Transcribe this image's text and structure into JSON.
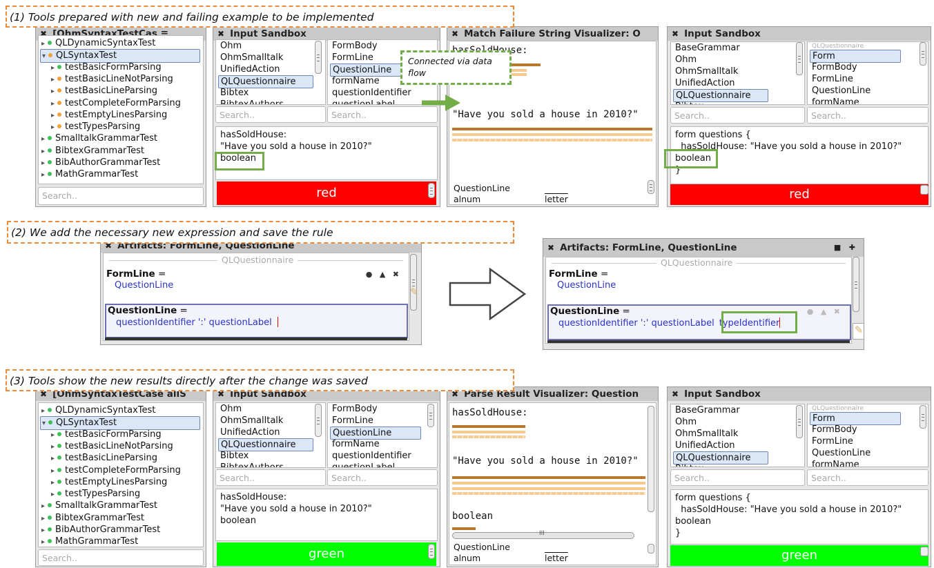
{
  "callouts": {
    "step1": "(1) Tools prepared with new and failing example to be implemented",
    "step2": "(2) We add the necessary new expression and save the rule",
    "step3": "(3) Tools show the new results directly after the change was saved",
    "dataflow": "Connected via data flow"
  },
  "top": {
    "test_runner": {
      "title": "[OhmSyntaxTestCas ≡",
      "items": [
        {
          "label": "QLDynamicSyntaxTest",
          "indent": 0,
          "status": "green",
          "expand": "▸",
          "selected": false
        },
        {
          "label": "QLSyntaxTest",
          "indent": 0,
          "status": "orange",
          "expand": "▾",
          "selected": true
        },
        {
          "label": "testBasicFormParsing",
          "indent": 1,
          "status": "green",
          "expand": "▸",
          "selected": false
        },
        {
          "label": "testBasicLineNotParsing",
          "indent": 1,
          "status": "orange",
          "expand": "▸",
          "selected": false
        },
        {
          "label": "testBasicLineParsing",
          "indent": 1,
          "status": "orange",
          "expand": "▸",
          "selected": false
        },
        {
          "label": "testCompleteFormParsing",
          "indent": 1,
          "status": "orange",
          "expand": "▸",
          "selected": false
        },
        {
          "label": "testEmptyLinesParsing",
          "indent": 1,
          "status": "orange",
          "expand": "▸",
          "selected": false
        },
        {
          "label": "testTypesParsing",
          "indent": 1,
          "status": "orange",
          "expand": "▸",
          "selected": false
        },
        {
          "label": "SmalltalkGrammarTest",
          "indent": 0,
          "status": "green",
          "expand": "▸",
          "selected": false
        },
        {
          "label": "BibtexGrammarTest",
          "indent": 0,
          "status": "green",
          "expand": "▸",
          "selected": false
        },
        {
          "label": "BibAuthorGrammarTest",
          "indent": 0,
          "status": "green",
          "expand": "▸",
          "selected": false
        },
        {
          "label": "MathGrammarTest",
          "indent": 0,
          "status": "green",
          "expand": "▸",
          "selected": false
        }
      ],
      "search_placeholder": "Search.."
    },
    "sandbox1": {
      "title": "Input Sandbox",
      "grammars": [
        "Ohm",
        "OhmSmalltalk",
        "UnifiedAction",
        "QLQuestionnaire",
        "Bibtex",
        "BibtexAuthors"
      ],
      "grammar_selected": 3,
      "rules": [
        "FormBody",
        "FormLine",
        "QuestionLine",
        "formName",
        "questionIdentifier",
        "questionLabel"
      ],
      "rule_selected": 2,
      "search_left": "Search..",
      "search_right": "Search..",
      "input_lines": [
        "hasSoldHouse:",
        "\"Have you sold a house in 2010?\"",
        "boolean"
      ],
      "status": "red"
    },
    "visualizer": {
      "title": "Match Failure String Visualizer: O",
      "line1": "hasSoldHouse:",
      "line2": "\"Have you sold a house in 2010?\"",
      "footer_rule": "QuestionLine",
      "footer_left": "alnum",
      "footer_right": "letter"
    },
    "sandbox2": {
      "title": "Input Sandbox",
      "grammars": [
        "BaseGrammar",
        "Ohm",
        "OhmSmalltalk",
        "UnifiedAction",
        "QLQuestionnaire",
        "Bibtex"
      ],
      "grammar_selected": 4,
      "rules_header": "QLQuestionnaire",
      "rules": [
        "Form",
        "FormBody",
        "FormLine",
        "QuestionLine",
        "formName"
      ],
      "rule_selected": 0,
      "search_left": "Search..",
      "search_right": "Search..",
      "input_lines": [
        "form questions {",
        "  hasSoldHouse: \"Have you sold a house in 2010?\"",
        "boolean",
        "}"
      ],
      "status": "red"
    }
  },
  "middle": {
    "before": {
      "title": "Artifacts: FormLine, QuestionLine",
      "grammar": "QLQuestionnaire",
      "rule1_name": "FormLine",
      "rule1_op": " =",
      "rule1_body": "QuestionLine",
      "rule2_name": "QuestionLine",
      "rule2_op": " =",
      "rule2_body": "questionIdentifier ':' questionLabel"
    },
    "after": {
      "title": "Artifacts: FormLine, QuestionLine",
      "grammar": "QLQuestionnaire",
      "rule1_name": "FormLine",
      "rule1_op": " =",
      "rule1_body": "QuestionLine",
      "rule2_name": "QuestionLine",
      "rule2_op": " =",
      "rule2_body": "questionIdentifier ':' questionLabel",
      "rule2_added": "typeIdentifier"
    }
  },
  "bottom": {
    "test_runner": {
      "title": "[OhmSyntaxTestCase allS",
      "items": [
        {
          "label": "QLDynamicSyntaxTest",
          "indent": 0,
          "status": "green",
          "expand": "▸",
          "selected": false
        },
        {
          "label": "QLSyntaxTest",
          "indent": 0,
          "status": "green",
          "expand": "▾",
          "selected": true
        },
        {
          "label": "testBasicFormParsing",
          "indent": 1,
          "status": "green",
          "expand": "▸",
          "selected": false
        },
        {
          "label": "testBasicLineNotParsing",
          "indent": 1,
          "status": "green",
          "expand": "▸",
          "selected": false
        },
        {
          "label": "testBasicLineParsing",
          "indent": 1,
          "status": "green",
          "expand": "▸",
          "selected": false
        },
        {
          "label": "testCompleteFormParsing",
          "indent": 1,
          "status": "green",
          "expand": "▸",
          "selected": false
        },
        {
          "label": "testEmptyLinesParsing",
          "indent": 1,
          "status": "green",
          "expand": "▸",
          "selected": false
        },
        {
          "label": "testTypesParsing",
          "indent": 1,
          "status": "green",
          "expand": "▸",
          "selected": false
        },
        {
          "label": "SmalltalkGrammarTest",
          "indent": 0,
          "status": "green",
          "expand": "▸",
          "selected": false
        },
        {
          "label": "BibtexGrammarTest",
          "indent": 0,
          "status": "green",
          "expand": "▸",
          "selected": false
        },
        {
          "label": "BibAuthorGrammarTest",
          "indent": 0,
          "status": "green",
          "expand": "▸",
          "selected": false
        },
        {
          "label": "MathGrammarTest",
          "indent": 0,
          "status": "green",
          "expand": "▸",
          "selected": false
        }
      ],
      "search_placeholder": "Search.."
    },
    "sandbox1": {
      "title": "Input Sandbox",
      "grammars": [
        "Ohm",
        "OhmSmalltalk",
        "UnifiedAction",
        "QLQuestionnaire",
        "Bibtex",
        "BibtexAuthors"
      ],
      "grammar_selected": 3,
      "rules": [
        "FormBody",
        "FormLine",
        "QuestionLine",
        "formName",
        "questionIdentifier",
        "questionLabel"
      ],
      "rule_selected": 2,
      "search_left": "Search..",
      "search_right": "Search..",
      "input_lines": [
        "hasSoldHouse:",
        "\"Have you sold a house in 2010?\"",
        "boolean"
      ],
      "status": "green"
    },
    "visualizer": {
      "title": "Parse Result Visualizer: Question",
      "line1": "hasSoldHouse:",
      "line2": "\"Have you sold a house in 2010?\"",
      "line3": "boolean",
      "footer_rule": "QuestionLine",
      "footer_left": "alnum",
      "footer_right": "letter"
    },
    "sandbox2": {
      "title": "Input Sandbox",
      "grammars": [
        "BaseGrammar",
        "Ohm",
        "OhmSmalltalk",
        "UnifiedAction",
        "QLQuestionnaire",
        "Bibtex"
      ],
      "grammar_selected": 4,
      "rules_header": "QLQuestionnaire",
      "rules": [
        "Form",
        "FormBody",
        "FormLine",
        "QuestionLine",
        "formName"
      ],
      "rule_selected": 0,
      "search_left": "Search..",
      "search_right": "Search..",
      "input_lines": [
        "form questions {",
        "  hasSoldHouse: \"Have you sold a house in 2010?\"",
        "boolean",
        "}"
      ],
      "status": "green"
    }
  },
  "colors": {
    "red": "#ff0000",
    "green": "#00ff00",
    "dot_green": "#3fbf5a",
    "dot_orange": "#f0a035",
    "callout_border": "#ed8a3a",
    "highlight_box": "#72ad47",
    "bar_dark": "#b87a2a",
    "bar_light": "#f7c98e"
  }
}
